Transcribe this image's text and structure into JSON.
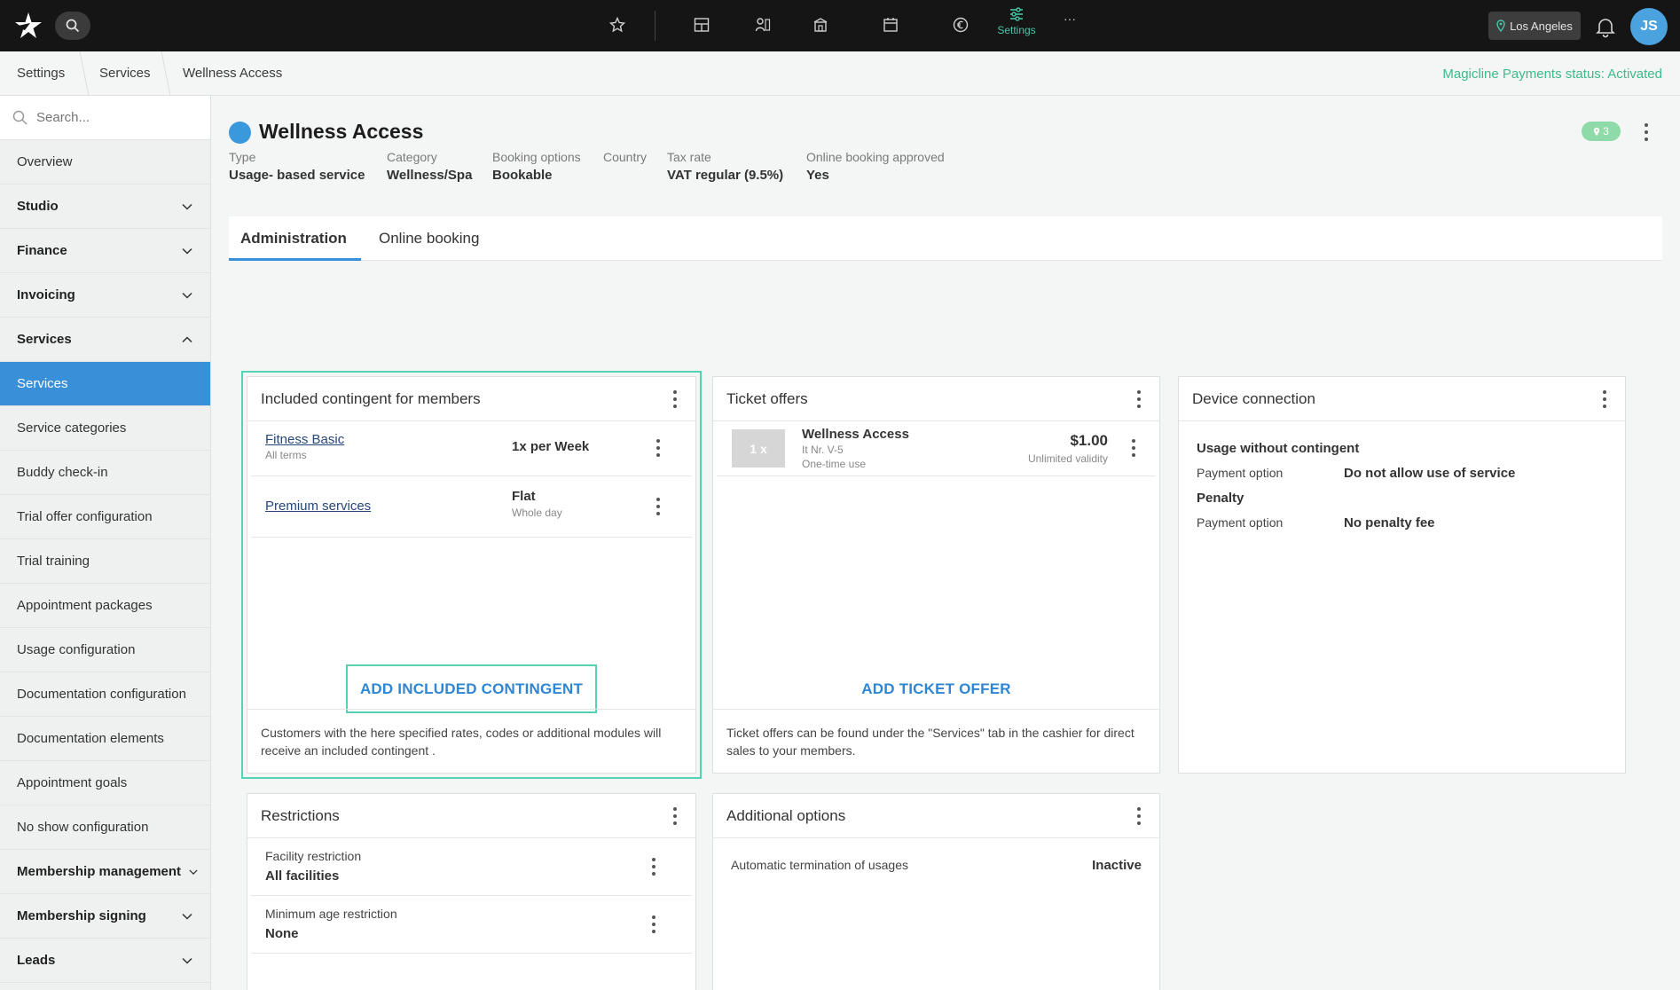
{
  "topbar": {
    "nav_items": [
      "star-icon",
      "dashboard-icon",
      "customers-icon",
      "studio-icon",
      "calendar-icon",
      "euro-icon",
      "settings-icon",
      "more-icon"
    ],
    "settings_label": "Settings",
    "more_label": "···",
    "location": "Los Angeles",
    "avatar_initials": "JS",
    "accent_color": "#46c6a8"
  },
  "breadcrumb": {
    "items": [
      "Settings",
      "Services",
      "Wellness Access"
    ],
    "payment_status": "Magicline Payments status: Activated"
  },
  "sidebar": {
    "search_placeholder": "Search...",
    "items": [
      {
        "label": "Overview"
      },
      {
        "label": "Studio"
      },
      {
        "label": "Finance"
      },
      {
        "label": "Invoicing"
      },
      {
        "label": "Services"
      },
      {
        "label": "Services"
      },
      {
        "label": "Service categories"
      },
      {
        "label": "Buddy check-in"
      },
      {
        "label": "Trial offer configuration"
      },
      {
        "label": "Trial training"
      },
      {
        "label": "Appointment packages"
      },
      {
        "label": "Usage configuration"
      },
      {
        "label": "Documentation configuration"
      },
      {
        "label": "Documentation elements"
      },
      {
        "label": "Appointment goals"
      },
      {
        "label": "No show configuration"
      },
      {
        "label": "Membership management"
      },
      {
        "label": "Membership signing"
      },
      {
        "label": "Leads"
      }
    ]
  },
  "header": {
    "title": "Wellness Access",
    "badge_count": "3",
    "meta": [
      {
        "label": "Type",
        "value": "Usage- based service"
      },
      {
        "label": "Category",
        "value": "Wellness/Spa"
      },
      {
        "label": "Booking options",
        "value": "Bookable"
      },
      {
        "label": "Country",
        "value": ""
      },
      {
        "label": "Tax rate",
        "value": "VAT regular (9.5%)"
      },
      {
        "label": "Online booking approved",
        "value": "Yes"
      }
    ]
  },
  "tabs": [
    "Administration",
    "Online booking"
  ],
  "contingent": {
    "title": "Included contingent for members",
    "rows": [
      {
        "name": "Fitness Basic",
        "sub": "All terms",
        "value": "1x per Week",
        "value_sub": ""
      },
      {
        "name": "Premium services",
        "sub": "",
        "value": "Flat",
        "value_sub": "Whole day"
      }
    ],
    "add_label": "ADD INCLUDED CONTINGENT",
    "footer": "Customers with the here specified rates, codes or additional modules will receive an included contingent ."
  },
  "tickets": {
    "title": "Ticket offers",
    "item": {
      "thumb": "1 x",
      "name": "Wellness Access",
      "number": "It Nr. V-5",
      "usage": "One-time use",
      "price": "$1.00",
      "validity": "Unlimited validity"
    },
    "add_label": "ADD TICKET OFFER",
    "footer": "Ticket offers can be found under the \"Services\" tab in the cashier for direct sales to your members."
  },
  "device": {
    "title": "Device connection",
    "section1": "Usage without contingent",
    "row1_label": "Payment option",
    "row1_value": "Do not allow use of service",
    "section2": "Penalty",
    "row2_label": "Payment option",
    "row2_value": "No penalty fee"
  },
  "restrictions": {
    "title": "Restrictions",
    "rows": [
      {
        "label": "Facility restriction",
        "value": "All facilities"
      },
      {
        "label": "Minimum age restriction",
        "value": "None"
      }
    ]
  },
  "additional": {
    "title": "Additional options",
    "row_label": "Automatic termination of usages",
    "row_value": "Inactive"
  }
}
